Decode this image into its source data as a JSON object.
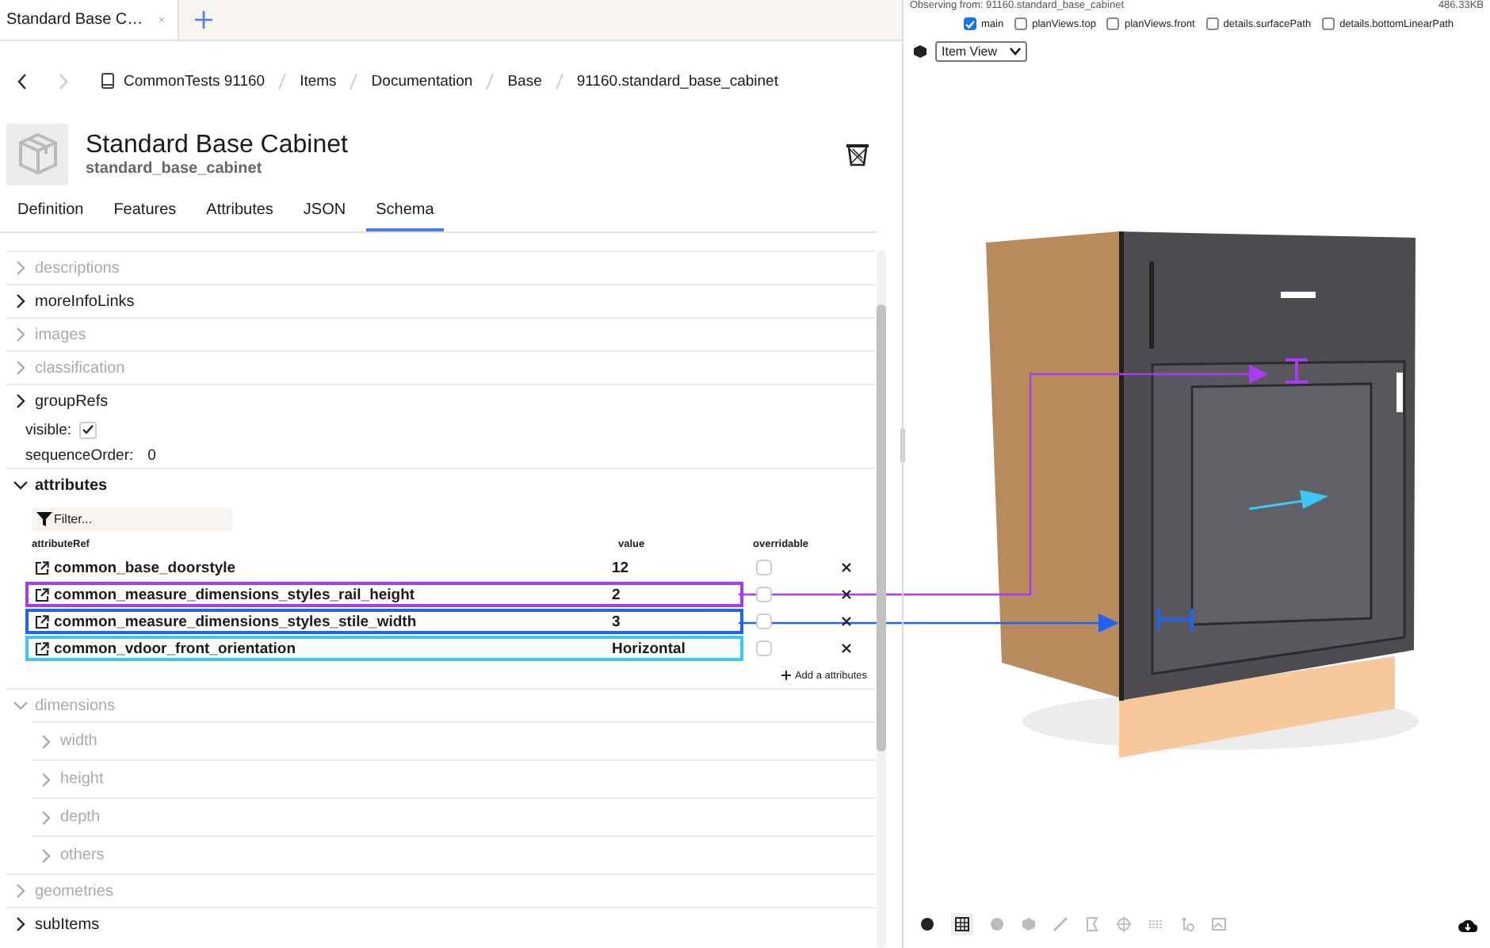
{
  "browser_tabs": [
    {
      "label": "Standard Base C…",
      "selected": true
    }
  ],
  "breadcrumb": [
    "CommonTests 91160",
    "Items",
    "Documentation",
    "Base",
    "91160.standard_base_cabinet"
  ],
  "item": {
    "title": "Standard Base Cabinet",
    "code": "standard_base_cabinet"
  },
  "tabs": [
    {
      "label": "Definition",
      "selected": false
    },
    {
      "label": "Features",
      "selected": false
    },
    {
      "label": "Attributes",
      "selected": false
    },
    {
      "label": "JSON",
      "selected": false
    },
    {
      "label": "Schema",
      "selected": true
    }
  ],
  "schema": [
    {
      "kind": "section",
      "label": "descriptions",
      "disabled": true,
      "expanded": false
    },
    {
      "kind": "section",
      "label": "moreInfoLinks",
      "disabled": false,
      "expanded": false
    },
    {
      "kind": "section",
      "label": "images",
      "disabled": true,
      "expanded": false
    },
    {
      "kind": "section",
      "label": "classification",
      "disabled": true,
      "expanded": false
    },
    {
      "kind": "section",
      "label": "groupRefs",
      "disabled": false,
      "expanded": false
    },
    {
      "kind": "checkbox",
      "label": "visible:",
      "checked": true
    },
    {
      "kind": "value",
      "label": "sequenceOrder:",
      "value": "0"
    },
    {
      "kind": "table",
      "label": "attributes",
      "expanded": true,
      "filter_placeholder": "Filter...",
      "columns": [
        "attributeRef",
        "value",
        "overridable"
      ],
      "add_label": "Add a attributes",
      "rows": [
        {
          "name": "common_base_doorstyle",
          "value": "12",
          "overridable": false
        },
        {
          "name": "common_measure_dimensions_styles_rail_height",
          "value": "2",
          "overridable": false,
          "color": "#a83cf0"
        },
        {
          "name": "common_measure_dimensions_styles_stile_width",
          "value": "3",
          "overridable": false,
          "color": "#1f64f0"
        },
        {
          "name": "common_vdoor_front_orientation",
          "value": "Horizontal",
          "overridable": false,
          "color": "#3cc8f5"
        }
      ]
    },
    {
      "kind": "section",
      "label": "dimensions",
      "disabled": true,
      "expanded": true,
      "children": [
        {
          "label": "width",
          "disabled": true,
          "expanded": false
        },
        {
          "label": "height",
          "disabled": true,
          "expanded": false
        },
        {
          "label": "depth",
          "disabled": true,
          "expanded": false
        },
        {
          "label": "others",
          "disabled": true,
          "expanded": false
        }
      ]
    },
    {
      "kind": "section",
      "label": "geometries",
      "disabled": true,
      "expanded": false
    },
    {
      "kind": "section",
      "label": "subItems",
      "disabled": false,
      "expanded": false
    }
  ],
  "viewer": {
    "status": "Observing from: 91160.standard_base_cabinet",
    "size": "486.33KB",
    "layers": [
      {
        "label": "main",
        "checked": true
      },
      {
        "label": "planViews.top",
        "checked": false
      },
      {
        "label": "planViews.front",
        "checked": false
      },
      {
        "label": "details.surfacePath",
        "checked": false
      },
      {
        "label": "details.bottomLinearPath",
        "checked": false
      }
    ],
    "view_select": "Item View"
  }
}
